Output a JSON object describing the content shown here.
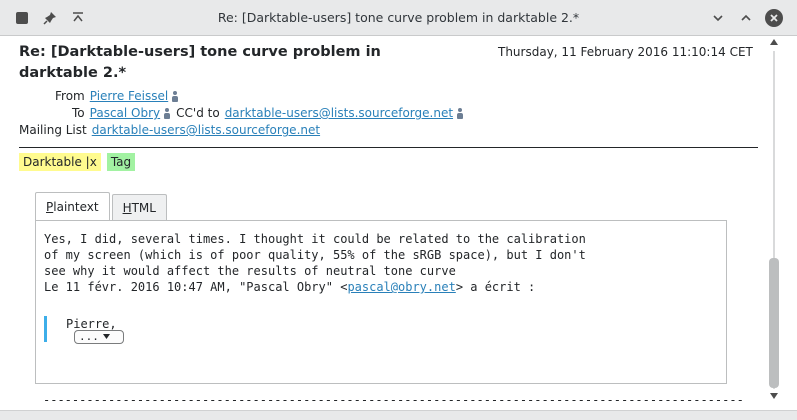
{
  "window": {
    "title": "Re: [Darktable-users] tone curve problem in darktable 2.*"
  },
  "message": {
    "subject": "Re: [Darktable-users] tone curve problem in darktable 2.*",
    "date": "Thursday, 11 February 2016 11:10:14 CET",
    "from_label": "From",
    "from": "Pierre Feissel",
    "to_label": "To",
    "to": "Pascal Obry",
    "cc_label": "CC'd to",
    "cc": "darktable-users@lists.sourceforge.net",
    "mailing_list_label": "Mailing List",
    "mailing_list": "darktable-users@lists.sourceforge.net"
  },
  "tags": [
    {
      "label": "Darktable |x",
      "color": "#fffb8f"
    },
    {
      "label": "Tag",
      "color": "#a2f2a2"
    }
  ],
  "tabs": {
    "plaintext": {
      "accel": "P",
      "rest": "laintext"
    },
    "html": {
      "accel": "H",
      "rest": "TML"
    }
  },
  "body": {
    "line1": "Yes, I did, several times. I thought it could be related to the calibration",
    "line2": "of my screen (which is of poor quality, 55% of the sRGB space), but I don't",
    "line3": "see why it would affect the results of neutral tone curve",
    "attrib_prefix": "Le 11 févr. 2016 10:47 AM, \"Pascal Obry\" <",
    "attrib_email": "pascal@obry.net",
    "attrib_suffix": "> a écrit :",
    "quote": "Pierre,",
    "collapse_label": "...",
    "separator": "------------------------------------------------------------------------------------------------------"
  },
  "icons": {
    "app_menu": "app-menu-icon",
    "pin": "pin-icon",
    "keep_above": "keep-above-icon",
    "minimize": "minimize-icon",
    "maximize": "maximize-icon",
    "close": "close-icon"
  },
  "colors": {
    "link": "#2980b9",
    "quote_bar": "#3daee9"
  }
}
